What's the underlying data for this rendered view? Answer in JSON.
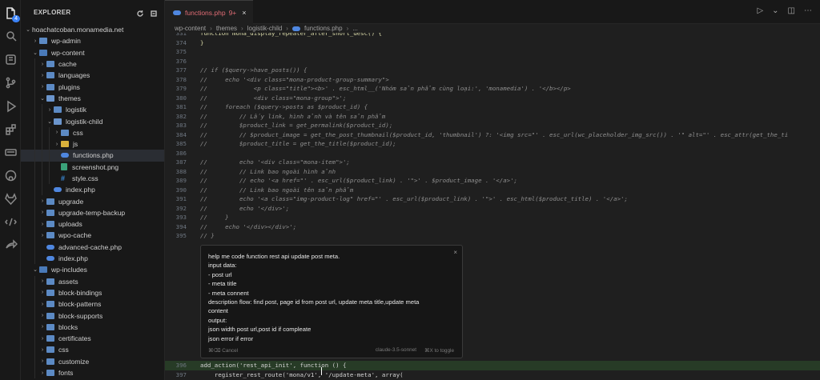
{
  "activity": {
    "icons": [
      "files-icon",
      "search-icon",
      "source-control-icon",
      "git-branch-icon",
      "run-debug-icon",
      "extensions-icon",
      "gpt-icon",
      "github-icon",
      "gitlab-icon",
      "remote-icon",
      "live-share-icon"
    ],
    "badge": "4"
  },
  "sidebar": {
    "title": "EXPLORER",
    "root": "hoachatcoban.monamedia.net",
    "items": [
      {
        "label": "wp-admin",
        "type": "folder",
        "depth": 1,
        "open": false
      },
      {
        "label": "wp-content",
        "type": "folder-wp",
        "depth": 1,
        "open": true
      },
      {
        "label": "cache",
        "type": "folder",
        "depth": 2,
        "open": false
      },
      {
        "label": "languages",
        "type": "folder",
        "depth": 2,
        "open": false
      },
      {
        "label": "plugins",
        "type": "folder",
        "depth": 2,
        "open": false
      },
      {
        "label": "themes",
        "type": "folder",
        "depth": 2,
        "open": true
      },
      {
        "label": "logistik",
        "type": "folder",
        "depth": 3,
        "open": false
      },
      {
        "label": "logistik-child",
        "type": "folder",
        "depth": 3,
        "open": true
      },
      {
        "label": "css",
        "type": "folder",
        "depth": 4,
        "open": false
      },
      {
        "label": "js",
        "type": "folder-js",
        "depth": 4,
        "open": false
      },
      {
        "label": "functions.php",
        "type": "php",
        "depth": 4,
        "selected": true
      },
      {
        "label": "screenshot.png",
        "type": "img",
        "depth": 4
      },
      {
        "label": "style.css",
        "type": "css",
        "depth": 4
      },
      {
        "label": "index.php",
        "type": "php",
        "depth": 3
      },
      {
        "label": "upgrade",
        "type": "folder",
        "depth": 2,
        "open": false
      },
      {
        "label": "upgrade-temp-backup",
        "type": "folder",
        "depth": 2,
        "open": false
      },
      {
        "label": "uploads",
        "type": "folder",
        "depth": 2,
        "open": false
      },
      {
        "label": "wpo-cache",
        "type": "folder",
        "depth": 2,
        "open": false
      },
      {
        "label": "advanced-cache.php",
        "type": "php",
        "depth": 2
      },
      {
        "label": "index.php",
        "type": "php",
        "depth": 2
      },
      {
        "label": "wp-includes",
        "type": "folder-wp",
        "depth": 1,
        "open": true
      },
      {
        "label": "assets",
        "type": "folder",
        "depth": 2,
        "open": false
      },
      {
        "label": "block-bindings",
        "type": "folder",
        "depth": 2,
        "open": false
      },
      {
        "label": "block-patterns",
        "type": "folder",
        "depth": 2,
        "open": false
      },
      {
        "label": "block-supports",
        "type": "folder",
        "depth": 2,
        "open": false
      },
      {
        "label": "blocks",
        "type": "folder",
        "depth": 2,
        "open": false
      },
      {
        "label": "certificates",
        "type": "folder",
        "depth": 2,
        "open": false
      },
      {
        "label": "css",
        "type": "folder",
        "depth": 2,
        "open": false
      },
      {
        "label": "customize",
        "type": "folder",
        "depth": 2,
        "open": false
      },
      {
        "label": "fonts",
        "type": "folder",
        "depth": 2,
        "open": false
      }
    ]
  },
  "tab": {
    "label": "functions.php",
    "status": "9+",
    "close": "×"
  },
  "breadcrumb": [
    "wp-content",
    "themes",
    "logistik-child",
    "functions.php",
    "..."
  ],
  "editor": {
    "lines": [
      {
        "n": "331",
        "t": "function mona_display_repeater_after_short_desc() {",
        "plain": true
      },
      {
        "n": "374",
        "t": "}",
        "plain": true
      },
      {
        "n": "375",
        "t": ""
      },
      {
        "n": "376",
        "t": ""
      },
      {
        "n": "377",
        "t": "// if ($query->have_posts()) {"
      },
      {
        "n": "378",
        "t": "//     echo '<div class=\"mona-product-group-summary\">"
      },
      {
        "n": "379",
        "t": "//             <p class=\"title\"><b>' . esc_html__('Nhóm sản phẩm cùng loại:', 'monamedia') . '</b></p>"
      },
      {
        "n": "380",
        "t": "//             <div class=\"mona-group\">';"
      },
      {
        "n": "381",
        "t": "//     foreach ($query->posts as $product_id) {"
      },
      {
        "n": "382",
        "t": "//         // Lấy link, hình ảnh và tên sản phẩm"
      },
      {
        "n": "383",
        "t": "//         $product_link = get_permalink($product_id);"
      },
      {
        "n": "384",
        "t": "//         // $product_image = get_the_post_thumbnail($product_id, 'thumbnail') ?: '<img src=\"' . esc_url(wc_placeholder_img_src()) . '\" alt=\"' . esc_attr(get_the_ti"
      },
      {
        "n": "385",
        "t": "//         $product_title = get_the_title($product_id);"
      },
      {
        "n": "386",
        "t": ""
      },
      {
        "n": "387",
        "t": "//         echo '<div class=\"mona-item\">';"
      },
      {
        "n": "388",
        "t": "//         // Link bao ngoài hình ảnh"
      },
      {
        "n": "389",
        "t": "//         // echo '<a href=\"' . esc_url($product_link) . '\">' . $product_image . '</a>';"
      },
      {
        "n": "390",
        "t": "//         // Link bao ngoài tên sản phẩm"
      },
      {
        "n": "391",
        "t": "//         echo '<a class=\"img-product-log\" href=\"' . esc_url($product_link) . '\">' . esc_html($product_title) . '</a>';"
      },
      {
        "n": "392",
        "t": "//         echo '</div>';"
      },
      {
        "n": "393",
        "t": "//     }"
      },
      {
        "n": "394",
        "t": "//     echo '</div></div>';"
      },
      {
        "n": "395",
        "t": "// }"
      }
    ],
    "bottom_lines": [
      {
        "n": "396",
        "t": "add_action('rest_api_init', function () {"
      },
      {
        "n": "397",
        "t": "    register_rest_route('mona/v1', '/update-meta', array("
      }
    ]
  },
  "prompt": {
    "lines": [
      "help me code function rest api update post meta.",
      "input data:",
      "- post url",
      "- meta title",
      "- meta connent",
      "description flow: find post, page id from post url, update meta title,update meta",
      "content",
      "output:",
      "json width post url,post id if compleate",
      "json error if error"
    ],
    "cancel": "⌘⌫ Cancel",
    "model": "claude-3.5-sonnet",
    "toggle": "⌘X to toggle",
    "close": "×"
  }
}
